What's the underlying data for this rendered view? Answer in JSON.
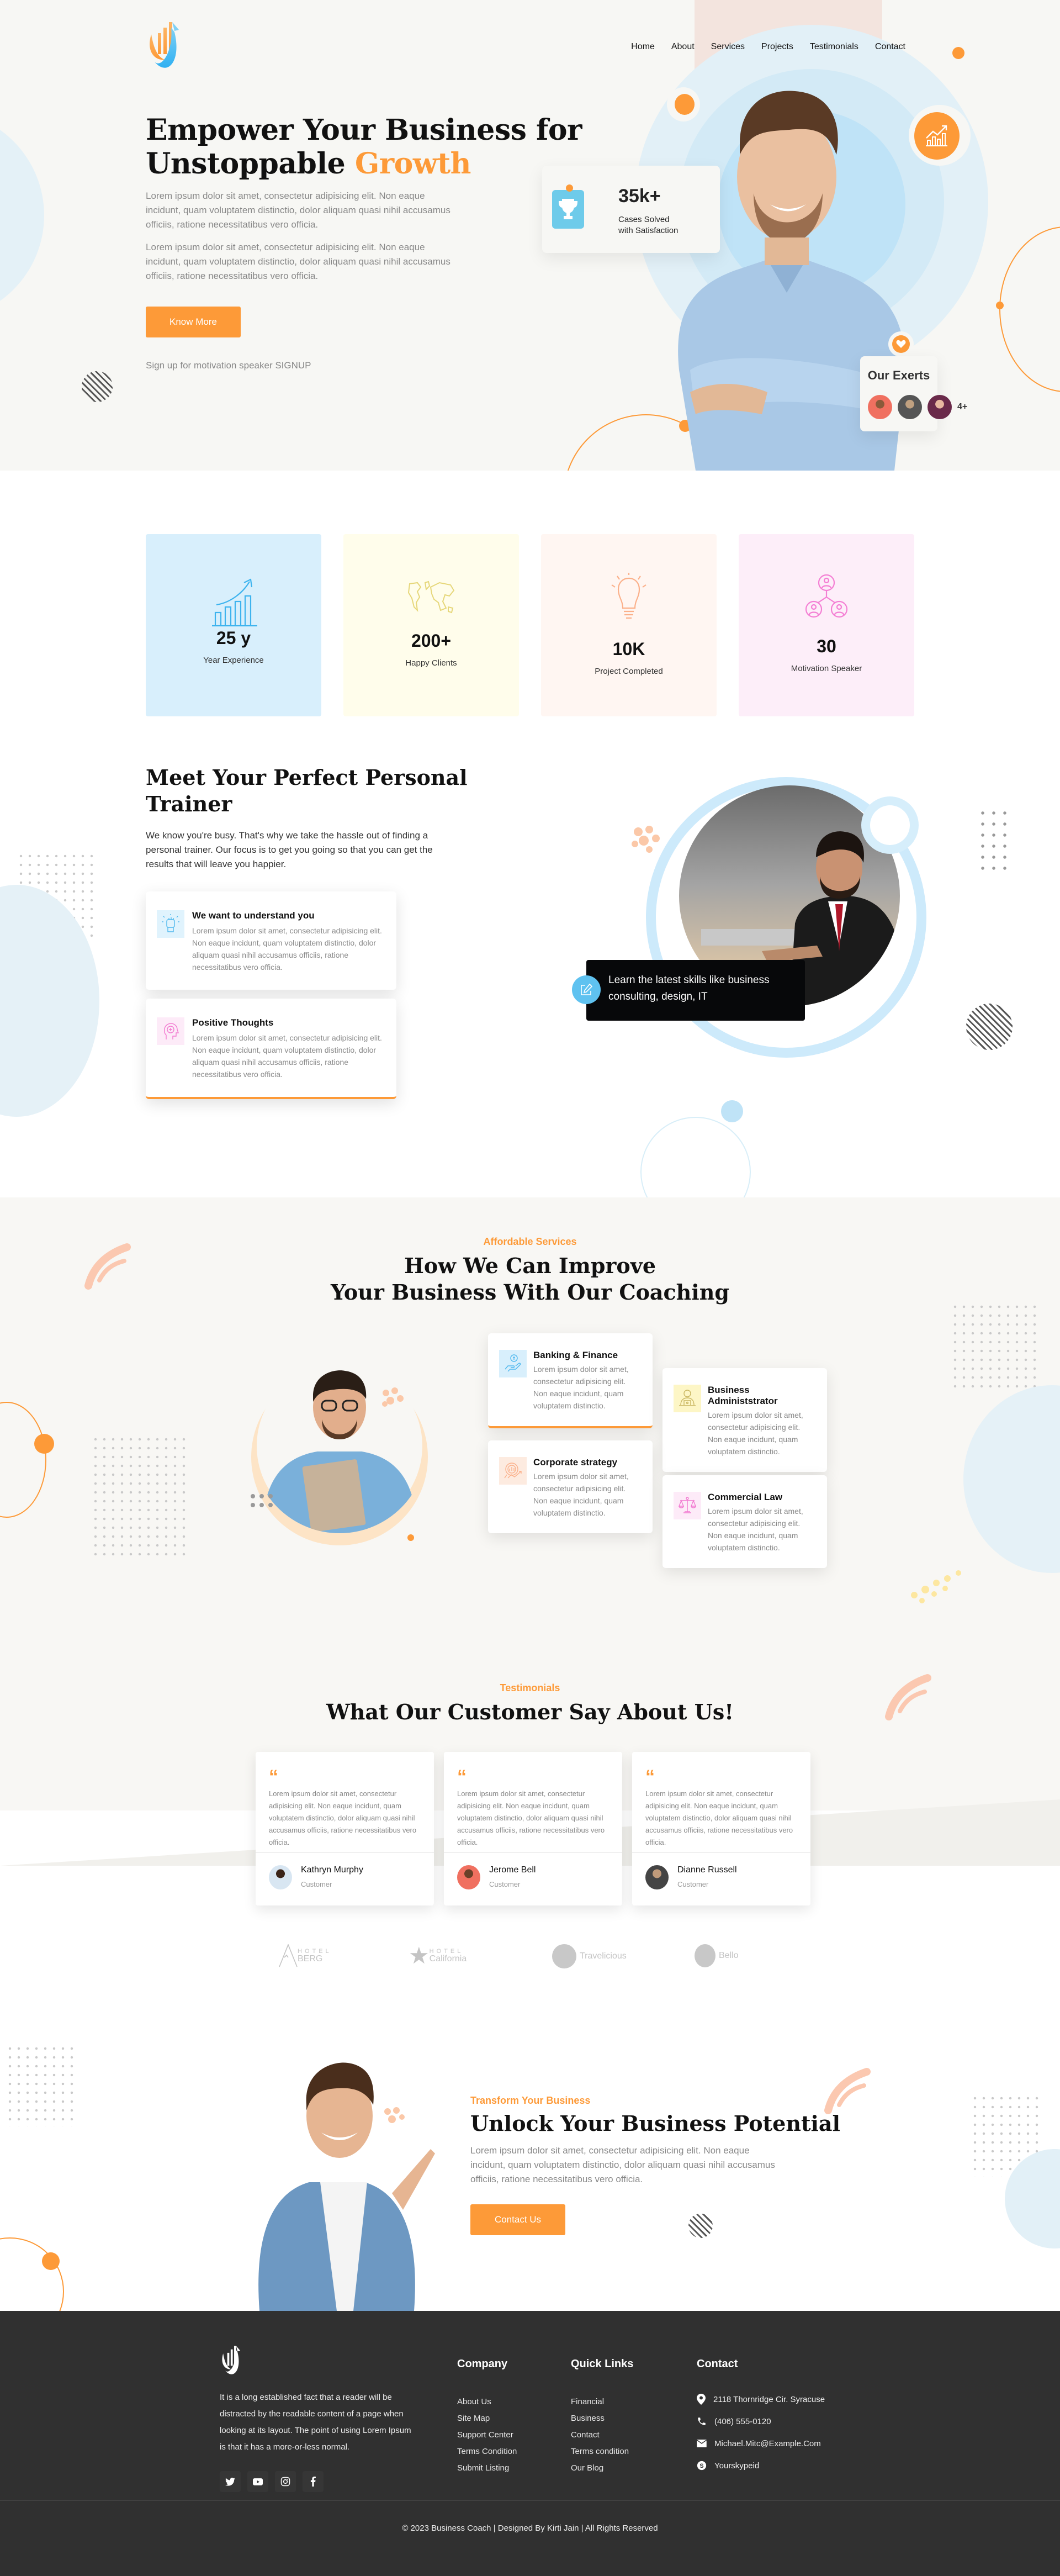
{
  "brand": {
    "accent": "#fd9a38",
    "blue": "#5fc2f0",
    "dark": "#303030"
  },
  "nav": {
    "items": [
      "Home",
      "About",
      "Services",
      "Projects",
      "Testimonials",
      "Contact"
    ]
  },
  "hero": {
    "title_line1": "Empower Your Business for",
    "title_line2": "Unstoppable",
    "title_highlight": "Growth",
    "para1": "Lorem ipsum dolor sit amet, consectetur adipisicing elit. Non eaque incidunt, quam voluptatem distinctio, dolor aliquam quasi nihil accusamus officiis, ratione necessitatibus vero officia.",
    "para2": "Lorem ipsum dolor sit amet, consectetur adipisicing elit. Non eaque incidunt, quam voluptatem distinctio, dolor aliquam quasi nihil accusamus officiis, ratione necessitatibus vero officia.",
    "button": "Know More",
    "signup": "Sign up for motivation speaker SIGNUP",
    "stat": {
      "value": "35k+",
      "label1": "Cases Solved",
      "label2": "with Satisfaction"
    },
    "experts": {
      "title": "Our Exerts",
      "more": "4+"
    }
  },
  "counters": [
    {
      "value": "25 y",
      "label": "Year Experience",
      "icon": "growth-chart-icon",
      "bg": "#d8effc",
      "color": "#3db3ee"
    },
    {
      "value": "200+",
      "label": "Happy Clients",
      "icon": "world-map-icon",
      "bg": "#fffdeb",
      "color": "#e6d77a"
    },
    {
      "value": "10K",
      "label": "Project Completed",
      "icon": "lightbulb-icon",
      "bg": "#fff6f2",
      "color": "#fbb08a"
    },
    {
      "value": "30",
      "label": "Motivation Speaker",
      "icon": "team-network-icon",
      "bg": "#fdeef9",
      "color": "#f47fd4"
    }
  ],
  "trainer": {
    "title_line1": "Meet Your Perfect Personal",
    "title_line2": "Trainer",
    "text": "We know you're busy. That's why we take the hassle out of finding a personal trainer. Our focus is to get you going so that you can get the results that will leave you happier.",
    "cards": [
      {
        "title": "We want to understand you",
        "text": "Lorem ipsum dolor sit amet, consectetur adipisicing elit. Non eaque incidunt, quam voluptatem distinctio, dolor aliquam quasi nihil accusamus officiis, ratione necessitatibus vero officia."
      },
      {
        "title": "Positive Thoughts",
        "text": "Lorem ipsum dolor sit amet, consectetur adipisicing elit. Non eaque incidunt, quam voluptatem distinctio, dolor aliquam quasi nihil accusamus officiis, ratione necessitatibus vero officia."
      }
    ],
    "badge": "Learn the latest skills like business consulting, design, IT"
  },
  "services": {
    "kicker": "Affordable Services",
    "title_line1": "How We Can Improve",
    "title_line2": "Your Business With Our Coaching",
    "cards": [
      {
        "title": "Banking & Finance",
        "text": "Lorem ipsum dolor sit amet, consectetur adipisicing elit. Non eaque incidunt, quam voluptatem distinctio."
      },
      {
        "title": "Business Administstrator",
        "text": "Lorem ipsum dolor sit amet, consectetur adipisicing elit. Non eaque incidunt, quam voluptatem distinctio."
      },
      {
        "title": "Corporate strategy",
        "text": "Lorem ipsum dolor sit amet, consectetur adipisicing elit. Non eaque incidunt, quam voluptatem distinctio."
      },
      {
        "title": "Commercial Law",
        "text": "Lorem ipsum dolor sit amet, consectetur adipisicing elit. Non eaque incidunt, quam voluptatem distinctio."
      }
    ]
  },
  "testimonials": {
    "kicker": "Testimonials",
    "title": "What Our Customer Say About Us!",
    "items": [
      {
        "text": "Lorem ipsum dolor sit amet, consectetur adipisicing elit. Non eaque incidunt, quam voluptatem distinctio, dolor aliquam quasi nihil accusamus officiis, ratione necessitatibus vero officia.",
        "name": "Kathryn Murphy",
        "role": "Customer"
      },
      {
        "text": "Lorem ipsum dolor sit amet, consectetur adipisicing elit. Non eaque incidunt, quam voluptatem distinctio, dolor aliquam quasi nihil accusamus officiis, ratione necessitatibus vero officia.",
        "name": "Jerome Bell",
        "role": "Customer"
      },
      {
        "text": "Lorem ipsum dolor sit amet, consectetur adipisicing elit. Non eaque incidunt, quam voluptatem distinctio, dolor aliquam quasi nihil accusamus officiis, ratione necessitatibus vero officia.",
        "name": "Dianne Russell",
        "role": "Customer"
      }
    ],
    "brands": [
      {
        "small": "HOTEL",
        "name": "BERG"
      },
      {
        "small": "HOTEL",
        "name": "California"
      },
      {
        "small": "",
        "name": "Travelicious"
      },
      {
        "small": "",
        "name": "Bello"
      }
    ]
  },
  "cta": {
    "kicker": "Transform Your Business",
    "title": "Unlock Your Business Potential",
    "text": "Lorem ipsum dolor sit amet, consectetur adipisicing elit. Non eaque incidunt, quam voluptatem distinctio, dolor aliquam quasi nihil accusamus officiis, ratione necessitatibus vero officia.",
    "button": "Contact Us"
  },
  "footer": {
    "about": "It is a long established fact that a reader will be distracted by the readable content of a page when looking at its layout. The point of using Lorem Ipsum is that it has a more-or-less normal.",
    "company_title": "Company",
    "company_links": [
      "About Us",
      "Site Map",
      "Support Center",
      "Terms Condition",
      "Submit Listing"
    ],
    "quick_title": "Quick Links",
    "quick_links": [
      "Financial",
      "Business",
      "Contact",
      "Terms condition",
      "Our Blog"
    ],
    "contact_title": "Contact",
    "address": "2118 Thornridge Cir. Syracuse",
    "phone": "(406) 555-0120",
    "email": "Michael.Mitc@Example.Com",
    "skype": "Yourskypeid",
    "copyright": "© 2023 Business Coach | Designed By Kirti Jain | All Rights Reserved"
  }
}
